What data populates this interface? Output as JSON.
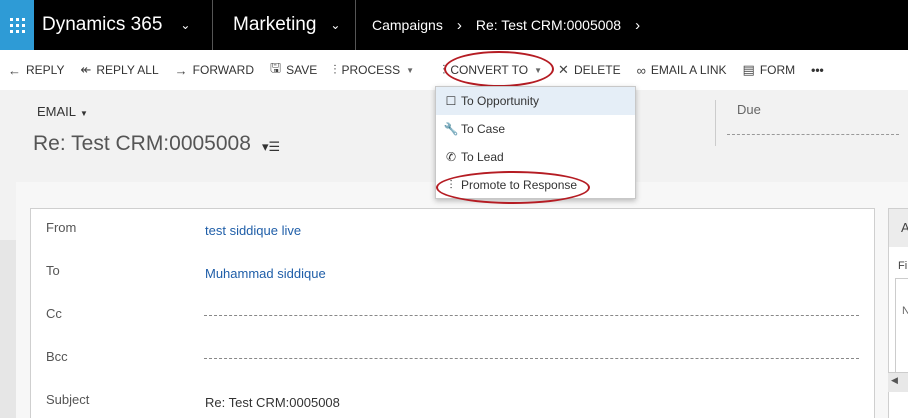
{
  "topbar": {
    "app_name": "Dynamics 365",
    "module": "Marketing",
    "breadcrumb": [
      "Campaigns",
      "Re: Test CRM:0005008"
    ]
  },
  "commands": {
    "reply": "REPLY",
    "reply_all": "REPLY ALL",
    "forward": "FORWARD",
    "save": "SAVE",
    "process": "PROCESS",
    "convert_to": "CONVERT TO",
    "delete": "DELETE",
    "email_link": "EMAIL A LINK",
    "form": "FORM",
    "more": "•••"
  },
  "convert_menu": {
    "items": [
      {
        "label": "To Opportunity",
        "icon": "opportunity-icon"
      },
      {
        "label": "To Case",
        "icon": "wrench-icon"
      },
      {
        "label": "To Lead",
        "icon": "phone-icon"
      },
      {
        "label": "Promote to Response",
        "icon": "person-icon"
      }
    ]
  },
  "header": {
    "entity_type": "EMAIL",
    "title": "Re: Test CRM:0005008",
    "due_label": "Due"
  },
  "form": {
    "from_label": "From",
    "from_value": "test siddique live",
    "to_label": "To",
    "to_value": "Muhammad siddique",
    "cc_label": "Cc",
    "bcc_label": "Bcc",
    "subject_label": "Subject",
    "subject_value": "Re: Test CRM:0005008"
  },
  "side_panel": {
    "header_letter": "A",
    "tab_label": "Fi",
    "content_letter": "N"
  },
  "colors": {
    "nav_bg": "#000000",
    "waffle_bg": "#2e9bd6",
    "link": "#1f5ea8",
    "annotation": "#b51c23",
    "menu_highlight": "#e5eef7"
  }
}
